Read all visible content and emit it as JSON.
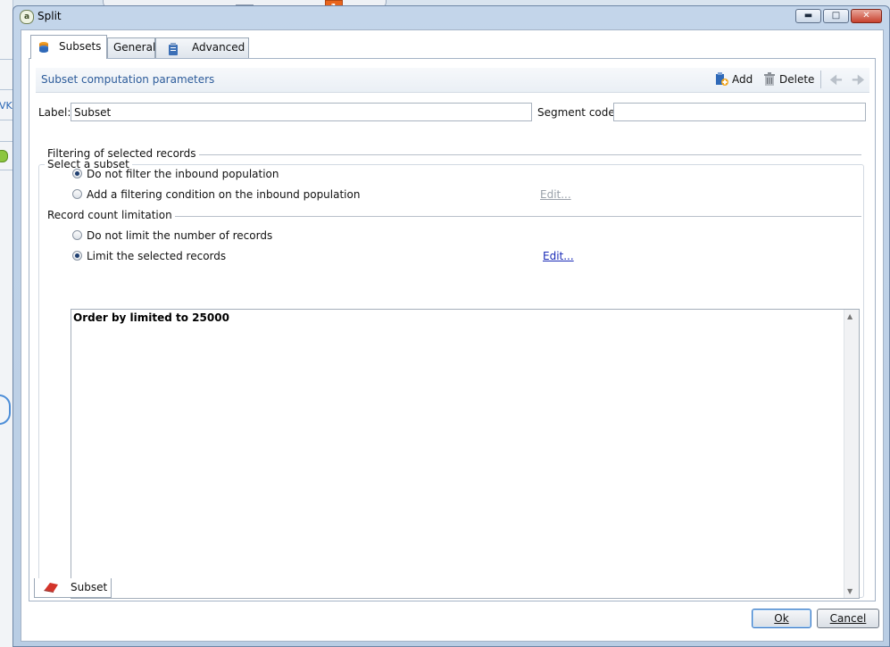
{
  "window": {
    "title": "Split",
    "notification_count": "1"
  },
  "tabs": [
    {
      "label": "Subsets"
    },
    {
      "label": "General"
    },
    {
      "label": "Advanced"
    }
  ],
  "panel": {
    "title": "Subset computation parameters",
    "add_label": "Add",
    "delete_label": "Delete"
  },
  "form": {
    "label_caption": "Label:",
    "label_value": "Subset",
    "segment_code_caption": "Segment code:",
    "segment_code_value": ""
  },
  "select_subset": {
    "legend": "Select a subset",
    "filtering": {
      "title": "Filtering of selected records",
      "options": [
        {
          "label": "Do not filter the inbound population",
          "checked": true
        },
        {
          "label": "Add a filtering condition on the inbound population",
          "checked": false
        }
      ],
      "edit_label": "Edit..."
    },
    "limitation": {
      "title": "Record count limitation",
      "options": [
        {
          "label": "Do not limit the number of records",
          "checked": false
        },
        {
          "label": "Limit the selected records",
          "checked": true
        }
      ],
      "edit_label": "Edit..."
    },
    "summary": "Order by  limited to 25000"
  },
  "bottom_tab": {
    "label": "Subset"
  },
  "footer": {
    "ok_label": "Ok",
    "cancel_label": "Cancel"
  },
  "background": {
    "left_text": "VKI"
  },
  "colors": {
    "accent": "#2c5b9a",
    "link": "#1a2bb7",
    "close_button": "#c8412e",
    "notification": "#e8641c"
  },
  "icons": [
    "app-icon",
    "database-icon",
    "clipboard-icon",
    "add-icon",
    "trash-icon",
    "arrow-left-icon",
    "arrow-right-icon",
    "eraser-icon"
  ]
}
